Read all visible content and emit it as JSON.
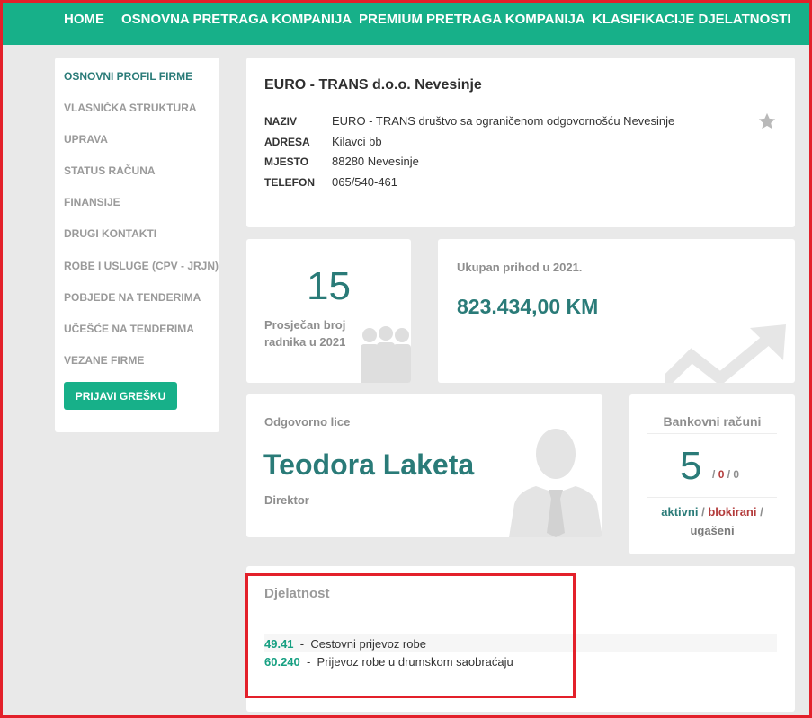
{
  "nav": {
    "items": [
      "HOME",
      "OSNOVNA PRETRAGA KOMPANIJA",
      "PREMIUM PRETRAGA KOMPANIJA",
      "KLASIFIKACIJE DJELATNOSTI"
    ]
  },
  "sidebar": {
    "items": [
      {
        "label": "OSNOVNI PROFIL FIRME",
        "active": true
      },
      {
        "label": "VLASNIČKA STRUKTURA"
      },
      {
        "label": "UPRAVA"
      },
      {
        "label": "STATUS RAČUNA"
      },
      {
        "label": "FINANSIJE"
      },
      {
        "label": "DRUGI KONTAKTI"
      },
      {
        "label": "ROBE I USLUGE (CPV - JRJN)"
      },
      {
        "label": "POBJEDE NA TENDERIMA"
      },
      {
        "label": "UČEŠĆE NA TENDERIMA"
      },
      {
        "label": "VEZANE FIRME"
      }
    ],
    "report_button": "PRIJAVI GREŠKU"
  },
  "company": {
    "title": "EURO - TRANS d.o.o. Nevesinje",
    "fields": [
      {
        "key": "NAZIV",
        "value": "EURO - TRANS društvo sa ograničenom odgovornošću Nevesinje"
      },
      {
        "key": "ADRESA",
        "value": "Kilavci bb"
      },
      {
        "key": "MJESTO",
        "value": "88280 Nevesinje"
      },
      {
        "key": "TELEFON",
        "value": "065/540-461"
      }
    ]
  },
  "employees": {
    "count": "15",
    "label_line1": "Prosječan broj",
    "label_line2": "radnika u 2021"
  },
  "revenue": {
    "title": "Ukupan prihod u 2021.",
    "value": "823.434,00 KM"
  },
  "responsible": {
    "title": "Odgovorno lice",
    "name": "Teodora Laketa",
    "role": "Direktor"
  },
  "bank": {
    "title": "Bankovni računi",
    "count": "5",
    "blocked": "0",
    "closed": "0",
    "sep": "/",
    "legend_active": "aktivni",
    "legend_blocked": "blokirani",
    "legend_closed": "ugašeni"
  },
  "activity": {
    "title": "Djelatnost",
    "rows": [
      {
        "code": "49.41",
        "label": "Cestovni prijevoz robe"
      },
      {
        "code": "60.240",
        "label": "Prijevoz robe u drumskom saobraćaju"
      }
    ]
  },
  "colors": {
    "brand": "#17b089",
    "accent_text": "#2a7b78",
    "alert_red": "#e3202a",
    "blocked": "#b33b3b"
  }
}
